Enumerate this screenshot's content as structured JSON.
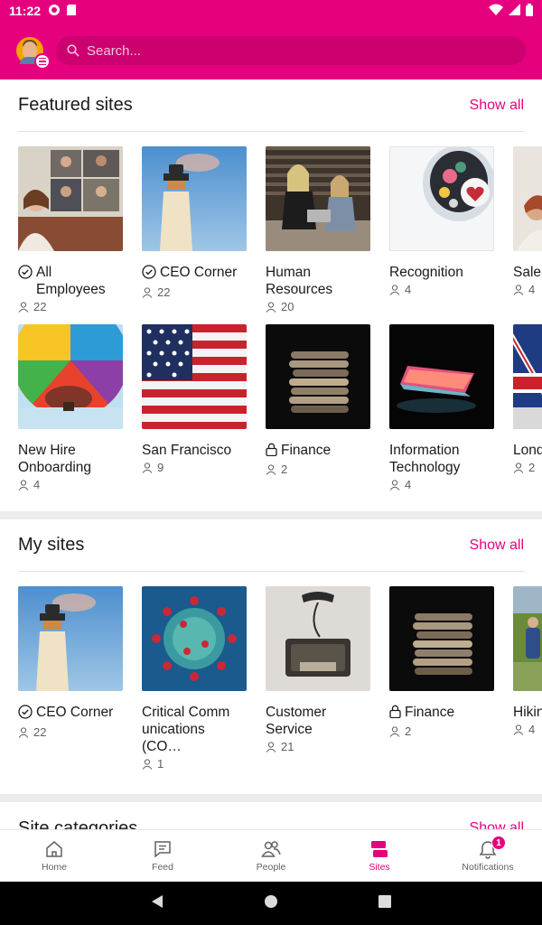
{
  "status_bar": {
    "time": "11:22"
  },
  "header": {
    "search_placeholder": "Search..."
  },
  "featured": {
    "title": "Featured sites",
    "show_all": "Show all",
    "row1": [
      {
        "name": "All Employees",
        "members": "22",
        "verified": true,
        "private": false,
        "image": "video-call-photo"
      },
      {
        "name": "CEO Corner",
        "members": "22",
        "verified": true,
        "private": false,
        "image": "lighthouse-photo"
      },
      {
        "name": "Human Resources",
        "members": "20",
        "verified": false,
        "private": false,
        "image": "two-women-laptop-photo"
      },
      {
        "name": "Recognition",
        "members": "4",
        "verified": false,
        "private": false,
        "image": "heart-jar-photo"
      },
      {
        "name": "Sale",
        "members": "4",
        "verified": false,
        "private": false,
        "image": "woman-portrait-photo"
      }
    ],
    "row2": [
      {
        "name": "New Hire Onboarding",
        "members": "4",
        "verified": false,
        "private": false,
        "image": "hot-air-balloon-photo"
      },
      {
        "name": "San Francisco",
        "members": "9",
        "verified": false,
        "private": false,
        "image": "us-flag-photo"
      },
      {
        "name": "Finance",
        "members": "2",
        "verified": false,
        "private": true,
        "image": "coins-photo"
      },
      {
        "name": "Information Technology",
        "members": "4",
        "verified": false,
        "private": false,
        "image": "laptop-glow-photo"
      },
      {
        "name": "Lond",
        "members": "2",
        "verified": false,
        "private": false,
        "image": "uk-flag-photo"
      }
    ]
  },
  "my_sites": {
    "title": "My sites",
    "show_all": "Show all",
    "items": [
      {
        "name": "CEO Corner",
        "members": "22",
        "verified": true,
        "private": false,
        "image": "lighthouse-photo"
      },
      {
        "name": "Critical Comm unications (CO…",
        "members": "1",
        "verified": false,
        "private": false,
        "image": "virus-photo"
      },
      {
        "name": "Customer Service",
        "members": "21",
        "verified": false,
        "private": false,
        "image": "old-telephone-photo"
      },
      {
        "name": "Finance",
        "members": "2",
        "verified": false,
        "private": true,
        "image": "coins-photo"
      },
      {
        "name": "Hikin",
        "members": "4",
        "verified": false,
        "private": false,
        "image": "hiking-photo"
      }
    ]
  },
  "categories": {
    "title": "Site categories",
    "show_all": "Show all"
  },
  "bottom_nav": {
    "items": [
      {
        "label": "Home",
        "icon": "home-icon"
      },
      {
        "label": "Feed",
        "icon": "feed-icon"
      },
      {
        "label": "People",
        "icon": "people-icon"
      },
      {
        "label": "Sites",
        "icon": "sites-icon"
      },
      {
        "label": "Notifications",
        "icon": "bell-icon"
      }
    ],
    "active": "Sites",
    "notification_count": "1"
  },
  "colors": {
    "brand": "#e5007d",
    "text": "#1a1a1a",
    "muted": "#5f5f5f"
  }
}
